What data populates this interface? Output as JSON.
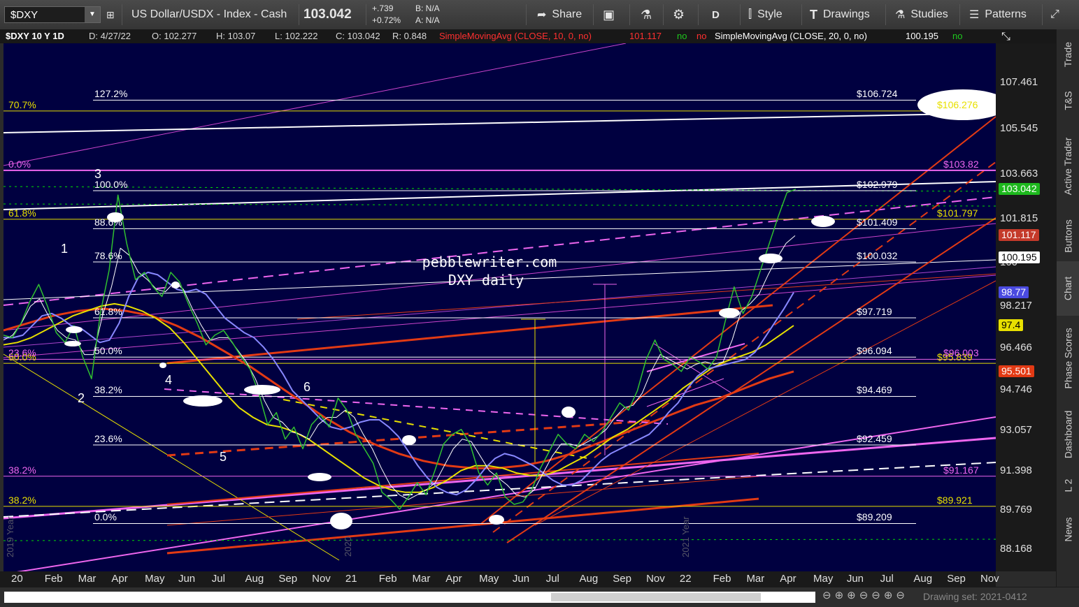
{
  "toolbar": {
    "symbol": "$DXY",
    "description": "US Dollar/USDX - Index - Cash",
    "last": "103.042",
    "change": "+.739",
    "change_pct": "+0.72%",
    "bid": "B: N/A",
    "ask": "A: N/A",
    "share": "Share",
    "period": "D",
    "style": "Style",
    "drawings": "Drawings",
    "studies": "Studies",
    "patterns": "Patterns"
  },
  "header": {
    "title": "$DXY 10 Y 1D",
    "date": "D: 4/27/22",
    "open": "O: 102.277",
    "high": "H: 103.07",
    "low": "L: 102.222",
    "close": "C: 103.042",
    "range": "R: 0.848",
    "sma10_label": "SimpleMovingAvg (CLOSE, 10, 0, no)",
    "sma10_value": "101.117",
    "sma10_flag1": "no",
    "sma10_flag2": "no",
    "sma20_label": "SimpleMovingAvg (CLOSE, 20, 0, no)",
    "sma20_value": "100.195",
    "sma20_flag": "no"
  },
  "sidebar": {
    "tabs": [
      "Trade",
      "T&S",
      "Active Trader",
      "Buttons",
      "Chart",
      "Phase Scores",
      "Dashboard",
      "L 2",
      "News"
    ]
  },
  "status": {
    "drawing_set": "Drawing set: 2021-0412"
  },
  "annotations": {
    "watermark1": "pebblewriter.com",
    "watermark2": "DXY daily",
    "year_2019": "2019 Year",
    "year_2020": "2020",
    "year_2021": "2021 Year",
    "wave_labels": [
      "1",
      "2",
      "3",
      "4",
      "5",
      "6"
    ]
  },
  "chart_data": {
    "type": "line",
    "title": "$DXY 10 Y 1D",
    "xlabel": "",
    "ylabel": "",
    "ylim": [
      87.5,
      109.5
    ],
    "x_ticks": [
      "20",
      "Feb",
      "Mar",
      "Apr",
      "May",
      "Jun",
      "Jul",
      "Aug",
      "Sep",
      "Nov",
      "21",
      "Feb",
      "Mar",
      "Apr",
      "May",
      "Jun",
      "Jul",
      "Aug",
      "Sep",
      "Nov",
      "22",
      "Feb",
      "Mar",
      "Apr",
      "May",
      "Jun",
      "Jul",
      "Aug",
      "Sep",
      "Nov"
    ],
    "y_ticks": [
      "107.461",
      "105.545",
      "103.663",
      "101.815",
      "100",
      "98.217",
      "96.466",
      "94.746",
      "93.057",
      "91.398",
      "89.769",
      "88.168"
    ],
    "y_tick_values": [
      107.461,
      105.545,
      103.663,
      101.815,
      100,
      98.217,
      96.466,
      94.746,
      93.057,
      91.398,
      89.769,
      88.168
    ],
    "price_badges": [
      {
        "text": "103.042",
        "value": 103.042,
        "bg": "#1db81d",
        "fg": "#ffffff"
      },
      {
        "text": "101.117",
        "value": 101.117,
        "bg": "#c43a2a",
        "fg": "#ffffff"
      },
      {
        "text": "100.195",
        "value": 100.195,
        "bg": "#ffffff",
        "fg": "#000000"
      },
      {
        "text": "98.77",
        "value": 98.77,
        "bg": "#4a4ae0",
        "fg": "#ffffff"
      },
      {
        "text": "97.4",
        "value": 97.4,
        "bg": "#e8e000",
        "fg": "#000000"
      },
      {
        "text": "95.501",
        "value": 95.501,
        "bg": "#e23a14",
        "fg": "#ffffff"
      }
    ],
    "fib_levels_white": [
      {
        "pct": "127.2%",
        "price": "$106.724",
        "value": 106.724
      },
      {
        "pct": "100.0%",
        "price": "$102.979",
        "value": 102.979
      },
      {
        "pct": "88.6%",
        "price": "$101.409",
        "value": 101.409
      },
      {
        "pct": "78.6%",
        "price": "$100.032",
        "value": 100.032
      },
      {
        "pct": "61.8%",
        "price": "$97.719",
        "value": 97.719
      },
      {
        "pct": "50.0%",
        "price": "$96.094",
        "value": 96.094
      },
      {
        "pct": "38.2%",
        "price": "$94.469",
        "value": 94.469
      },
      {
        "pct": "23.6%",
        "price": "$92.459",
        "value": 92.459
      },
      {
        "pct": "0.0%",
        "price": "$89.209",
        "value": 89.209
      }
    ],
    "fib_levels_yellow": [
      {
        "pct": "70.7%",
        "price": "$106.276",
        "value": 106.276
      },
      {
        "pct": "61.8%",
        "price": "$101.797",
        "value": 101.797
      },
      {
        "pct": "50.0%",
        "price": "$95.839",
        "value": 95.839
      },
      {
        "pct": "38.2%",
        "price": "$89.921",
        "value": 89.921
      }
    ],
    "fib_levels_magenta": [
      {
        "pct": "0.0%",
        "price": "$103.82",
        "value": 103.82
      },
      {
        "pct": "23.6%",
        "price": "$96.003",
        "value": 96.003
      },
      {
        "pct": "38.2%",
        "price": "$91.167",
        "value": 91.167
      }
    ],
    "series": [
      {
        "name": "$DXY",
        "color": "#30c030",
        "values": [
          97.0,
          96.9,
          97.5,
          98.4,
          99.1,
          98.2,
          97.1,
          96.7,
          97.4,
          96.1,
          95.2,
          97.9,
          99.7,
          102.8,
          100.8,
          99.3,
          99.6,
          99.0,
          98.6,
          99.6,
          99.2,
          98.3,
          97.5,
          96.6,
          97.0,
          97.2,
          96.7,
          96.1,
          95.6,
          94.6,
          93.3,
          93.8,
          92.7,
          93.2,
          92.3,
          93.3,
          93.7,
          93.2,
          94.4,
          93.9,
          92.9,
          92.3,
          91.7,
          90.5,
          90.2,
          89.8,
          90.3,
          90.9,
          90.4,
          91.4,
          92.5,
          92.9,
          93.1,
          92.5,
          91.3,
          90.8,
          91.3,
          90.3,
          90.0,
          90.1,
          90.6,
          91.5,
          92.2,
          92.9,
          92.5,
          92.3,
          92.9,
          92.6,
          93.0,
          93.6,
          94.2,
          93.9,
          94.7,
          96.0,
          96.8,
          96.0,
          95.8,
          95.5,
          96.1,
          95.9,
          95.6,
          96.1,
          97.6,
          99.0,
          97.9,
          98.6,
          99.7,
          100.8,
          101.9,
          102.9,
          103.042
        ]
      },
      {
        "name": "SimpleMovingAvg (CLOSE, 10, 0, no)",
        "color": "#ffffff",
        "values": [
          96.8,
          97.0,
          97.5,
          98.2,
          98.5,
          97.8,
          97.2,
          96.9,
          96.8,
          96.2,
          96.2,
          97.8,
          99.0,
          100.6,
          100.3,
          99.6,
          99.3,
          98.9,
          98.8,
          99.2,
          98.9,
          98.1,
          97.4,
          96.8,
          96.9,
          96.9,
          96.4,
          95.9,
          95.2,
          94.3,
          93.6,
          93.4,
          93.0,
          92.9,
          92.7,
          93.3,
          93.6,
          93.6,
          93.9,
          93.6,
          92.9,
          92.3,
          91.5,
          90.8,
          90.4,
          90.2,
          90.4,
          90.6,
          90.9,
          91.6,
          92.3,
          92.7,
          92.6,
          92.0,
          91.4,
          91.1,
          90.8,
          90.4,
          90.3,
          90.6,
          91.3,
          92.0,
          92.5,
          92.5,
          92.4,
          92.6,
          92.8,
          93.1,
          93.6,
          94.0,
          94.1,
          94.6,
          95.5,
          96.2,
          96.0,
          95.8,
          95.6,
          95.8,
          95.9,
          95.8,
          95.9,
          96.8,
          98.0,
          98.3,
          98.7,
          99.5,
          100.2,
          100.8,
          101.117
        ]
      },
      {
        "name": "SimpleMovingAvg (CLOSE, 20, 0, no)",
        "color": "#8888ff",
        "values": [
          96.9,
          96.9,
          97.0,
          97.4,
          97.8,
          97.9,
          97.7,
          97.4,
          97.3,
          97.0,
          96.7,
          96.8,
          97.5,
          98.6,
          99.4,
          99.6,
          99.5,
          99.2,
          98.9,
          98.8,
          98.9,
          98.7,
          98.2,
          97.7,
          97.4,
          97.1,
          96.9,
          96.5,
          96.0,
          95.4,
          94.7,
          94.3,
          93.9,
          93.5,
          93.2,
          93.1,
          93.2,
          93.4,
          93.5,
          93.5,
          93.2,
          92.8,
          92.2,
          91.6,
          91.1,
          90.7,
          90.5,
          90.4,
          90.6,
          91.0,
          91.5,
          91.9,
          92.1,
          92.0,
          91.8,
          91.6,
          91.3,
          91.0,
          90.8,
          90.8,
          91.0,
          91.4,
          91.8,
          92.1,
          92.3,
          92.5,
          92.7,
          92.9,
          93.3,
          93.8,
          94.2,
          94.8,
          95.3,
          95.6,
          95.7,
          95.8,
          95.9,
          96.0,
          96.3,
          96.9,
          97.5,
          98.1,
          98.77
        ]
      },
      {
        "name": "SMA 50",
        "color": "#e8e000",
        "values": [
          96.6,
          96.7,
          96.9,
          97.2,
          97.5,
          97.8,
          98.0,
          98.2,
          98.3,
          98.2,
          98.0,
          97.7,
          97.3,
          96.7,
          96.0,
          95.3,
          94.6,
          94.0,
          93.6,
          93.3,
          93.2,
          93.0,
          92.7,
          92.3,
          91.9,
          91.5,
          91.1,
          90.8,
          90.6,
          90.5,
          90.5,
          90.7,
          91.0,
          91.4,
          91.6,
          91.6,
          91.5,
          91.3,
          91.2,
          91.2,
          91.4,
          91.7,
          92.0,
          92.4,
          92.8,
          93.1,
          93.5,
          93.9,
          94.3,
          94.8,
          95.2,
          95.6,
          95.9,
          96.1,
          96.3,
          96.6,
          97.0,
          97.4
        ]
      },
      {
        "name": "SMA 200",
        "color": "#e23a14",
        "values": [
          97.2,
          97.5,
          97.8,
          98.0,
          98.1,
          98.0,
          97.8,
          97.4,
          96.9,
          96.3,
          95.7,
          95.0,
          94.3,
          93.6,
          93.0,
          92.5,
          92.1,
          91.8,
          91.6,
          91.5,
          91.5,
          91.6,
          91.8,
          92.1,
          92.5,
          92.9,
          93.3,
          93.7,
          94.1,
          94.4,
          94.8,
          95.2,
          95.501
        ]
      }
    ]
  }
}
